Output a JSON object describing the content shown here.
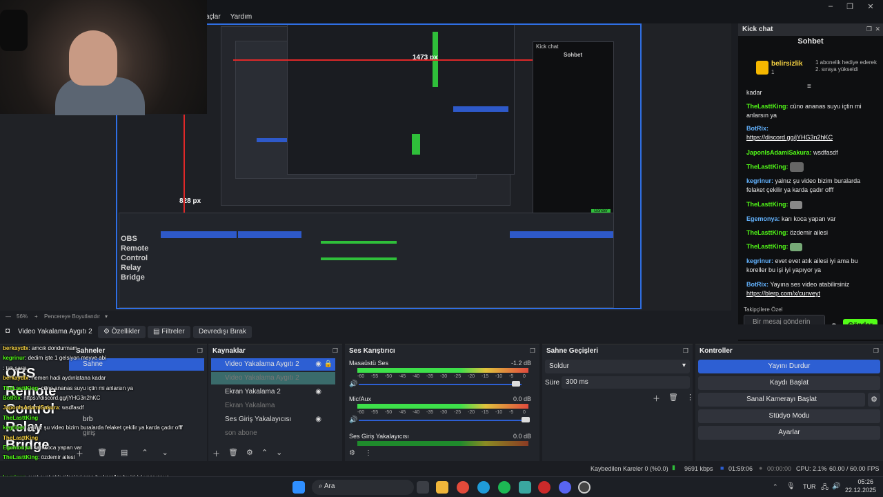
{
  "menu": {
    "items": [
      "açlar",
      "Yardım"
    ]
  },
  "window_controls": {
    "minimize": "–",
    "maximize": "❐",
    "close": "✕"
  },
  "preview": {
    "zoom_label": "56%",
    "fit_label": "Pencereye Boyutlandır",
    "px_label_1": "1473 px",
    "px_label_2": "828 px",
    "nested_overlay_text": "OBS Remote Control Relay Bridge",
    "nested_chat_header": "Kick chat",
    "nested_sohbet": "Sohbet",
    "nested_send": "Gönder"
  },
  "toolbar": {
    "source_name": "Video Yakalama Aygıtı 2",
    "properties": "Özellikler",
    "filters": "Filtreler",
    "deactivate": "Devredışı Bırak"
  },
  "chat": {
    "panel_title": "Kick chat",
    "tab": "Sohbet",
    "pinned_user": "belirsizlik",
    "pinned_count": "1",
    "pinned_msg": "1 abonelik hediye ederek 2. sıraya yükseldi",
    "partial_top": "kadar",
    "messages": [
      {
        "user": "TheLasttKing:",
        "text": "cüno ananas suyu içtin mi anlarsın ya"
      },
      {
        "user": "BotRix:",
        "text": "https://discord.gg/jYHG3n2hKC"
      },
      {
        "user": "JaponIsAdamiSakura:",
        "text": "wsdfasdf"
      },
      {
        "user": "TheLasttKing:",
        "text": ""
      },
      {
        "user": "kegrinur:",
        "text": "yalnız şu video bizim buralarda felaket çekilir ya karda çadır offf"
      },
      {
        "user": "TheLasttKing:",
        "text": ""
      },
      {
        "user": "Egemonya:",
        "text": "karı koca yapan var"
      },
      {
        "user": "TheLasttKing:",
        "text": "özdemir ailesi"
      },
      {
        "user": "TheLasttKing:",
        "text": ""
      },
      {
        "user": "kegrinur:",
        "text": "evet evet atık ailesi iyi ama bu koreller bu işi iyi yapıyor ya"
      },
      {
        "user": "BotRix:",
        "text": "Yayına ses video atabilirsiniz"
      },
      {
        "user": "",
        "text": "https://blerp.com/x/cunveyt"
      }
    ],
    "followers_only": "Takipçilere Özel",
    "input_placeholder": "Bir mesaj gönderin",
    "send": "Gönder"
  },
  "docks": {
    "scenes": {
      "title": "Sahneler",
      "items": [
        "Sahne",
        "brb",
        "giriş"
      ]
    },
    "sources": {
      "title": "Kaynaklar",
      "items": [
        {
          "label": "Video Yakalama Aygıtı 2",
          "state": "selected"
        },
        {
          "label": "Video Yakalama Aygıtı 2",
          "state": "dim"
        },
        {
          "label": "Ekran Yakalama 2",
          "state": "normal"
        },
        {
          "label": "Ekran Yakalama",
          "state": "dim"
        },
        {
          "label": "Ses Giriş Yakalayıcısı",
          "state": "normal"
        },
        {
          "label": "son abone",
          "state": "dim"
        }
      ]
    },
    "mixer": {
      "title": "Ses Karıştırıcı",
      "channels": [
        {
          "name": "Masaüstü Ses",
          "db": "-1.2 dB"
        },
        {
          "name": "Mic/Aux",
          "db": "0.0 dB"
        },
        {
          "name": "Ses Giriş Yakalayıcısı",
          "db": "0.0 dB"
        }
      ],
      "ticks": [
        "-60",
        "-55",
        "-50",
        "-45",
        "-40",
        "-35",
        "-30",
        "-25",
        "-20",
        "-15",
        "-10",
        "-5",
        "0"
      ]
    },
    "transitions": {
      "title": "Sahne Geçişleri",
      "type": "Soldur",
      "duration_label": "Süre",
      "duration": "300 ms"
    },
    "controls": {
      "title": "Kontroller",
      "buttons": [
        "Yayını Durdur",
        "Kaydı Başlat",
        "Sanal Kamerayı Başlat",
        "Stüdyo Modu",
        "Ayarlar"
      ]
    }
  },
  "status": {
    "dropped": "Kaybedilen Kareler 0 (%0.0)",
    "bitrate": "9691 kbps",
    "live_time": "01:59:06",
    "rec_time": "00:00:00",
    "cpu": "CPU: 2.1%",
    "fps": "60.00 / 60.00 FPS"
  },
  "overlay_chat": [
    {
      "user": "berkaydlx",
      "text": ": amcık dondurmam"
    },
    {
      "user": "kegrinur",
      "text": ": dedim işte 1 gelsiyon meyve abi"
    },
    {
      "user": "",
      "text": ": tak şarja"
    },
    {
      "user": "berkaydlx",
      "text": ": hemen hadi aydınlatana kadar"
    },
    {
      "user": "TheLasttKing",
      "text": ": cüno ananas suyu içtin mi anlarsın ya"
    },
    {
      "user": "BotRix",
      "text": ": https://discord.gg/jYHG3n2hKC"
    },
    {
      "user": "JaponIsAdamiSakura",
      "text": ": wsdfasdf"
    },
    {
      "user": "TheLasttKing",
      "text": ""
    },
    {
      "user": "kegrinur",
      "text": ": yalnız şu video bizim buralarda felaket çekilir ya karda çadır offf"
    },
    {
      "user": "TheLasttKing",
      "text": ""
    },
    {
      "user": "Egemonya",
      "text": ": karı koca yapan var"
    },
    {
      "user": "TheLasttKing",
      "text": ": özdemir ailesi"
    },
    {
      "user": "TheLasttKing",
      "text": ""
    },
    {
      "user": "kegrinur",
      "text": ": evet evet atık ailesi iyi ama bu koreller bu işi iyi yapıyor ya"
    },
    {
      "user": "BotRix",
      "text": ": Yayına ses video atabilirsiniz https://blerp.com/x/cunveyt"
    }
  ],
  "overlay_title": "OBS Remote Control Relay Bridge",
  "taskbar": {
    "search": "Ara",
    "lang": "TUR",
    "time": "05:26",
    "date": "22.12.2025"
  }
}
